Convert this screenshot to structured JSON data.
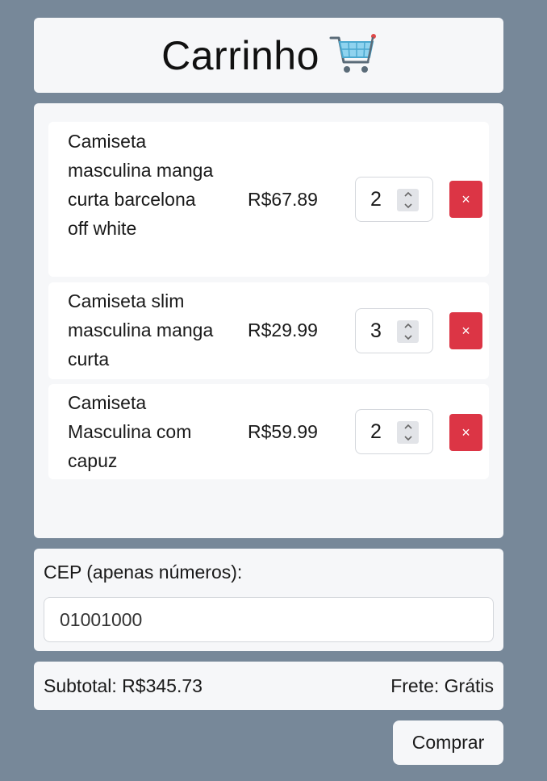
{
  "header": {
    "title": "Carrinho",
    "icon": "shopping-cart-icon"
  },
  "cart": {
    "items": [
      {
        "name": "Camiseta masculina manga curta barcelona off white",
        "price": "R$67.89",
        "quantity": "2",
        "remove_label": "×"
      },
      {
        "name": "Camiseta slim masculina manga curta",
        "price": "R$29.99",
        "quantity": "3",
        "remove_label": "×"
      },
      {
        "name": "Camiseta Masculina com capuz",
        "price": "R$59.99",
        "quantity": "2",
        "remove_label": "×"
      }
    ]
  },
  "shipping": {
    "cep_label": "CEP (apenas números):",
    "cep_value": "01001000"
  },
  "totals": {
    "subtotal": "Subtotal: R$345.73",
    "frete": "Frete: Grátis"
  },
  "actions": {
    "buy_label": "Comprar"
  },
  "colors": {
    "background": "#778899",
    "panel": "#f6f7f9",
    "remove": "#dc3545"
  }
}
